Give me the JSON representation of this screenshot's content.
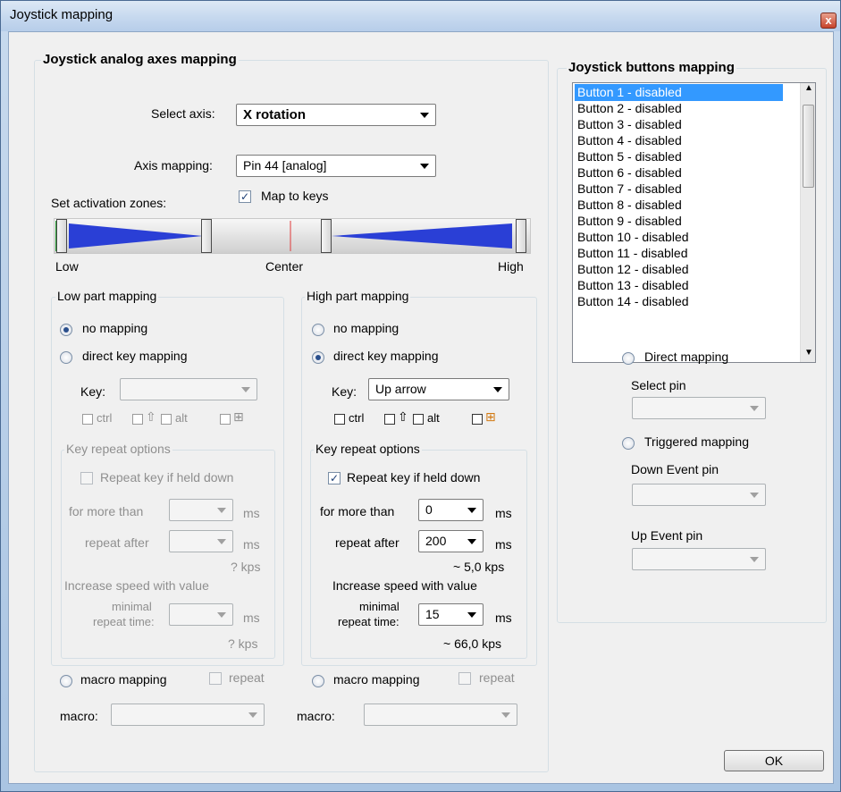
{
  "window": {
    "title": "Joystick mapping",
    "close_glyph": "x"
  },
  "analog": {
    "group_title": "Joystick analog axes mapping",
    "select_axis_label": "Select axis:",
    "select_axis_value": "X rotation",
    "axis_mapping_label": "Axis mapping:",
    "axis_mapping_value": "Pin 44 [analog]",
    "map_to_keys_label": "Map to keys",
    "map_to_keys_checked": true,
    "activation_label": "Set activation zones:",
    "zone_low": "Low",
    "zone_center": "Center",
    "zone_high": "High"
  },
  "low": {
    "title": "Low part mapping",
    "no_mapping": "no mapping",
    "direct": "direct key mapping",
    "key_label": "Key:",
    "key_value": "",
    "ctrl": "ctrl",
    "alt": "alt",
    "shift_glyph": "⇧",
    "win_glyph": "⊞",
    "repeat_group": "Key repeat options",
    "repeat_check": "Repeat key if held down",
    "for_more_than": "for more than",
    "repeat_after": "repeat after",
    "ms": "ms",
    "kps1": "? kps",
    "increase": "Increase speed with value",
    "minimal": "minimal",
    "repeat_time": "repeat time:",
    "kps2": "? kps",
    "macro_mapping": "macro mapping",
    "repeat": "repeat",
    "macro_label": "macro:"
  },
  "high": {
    "title": "High part mapping",
    "no_mapping": "no mapping",
    "direct": "direct key mapping",
    "key_label": "Key:",
    "key_value": "Up arrow",
    "ctrl": "ctrl",
    "alt": "alt",
    "shift_glyph": "⇧",
    "win_glyph": "⊞",
    "repeat_group": "Key repeat options",
    "repeat_check": "Repeat key if held down",
    "repeat_checked": true,
    "for_more_than": "for more than",
    "for_more_than_value": "0",
    "repeat_after": "repeat after",
    "repeat_after_value": "200",
    "ms": "ms",
    "kps1": "~ 5,0 kps",
    "increase": "Increase speed with value",
    "minimal": "minimal",
    "repeat_time": "repeat time:",
    "minimal_value": "15",
    "kps2": "~ 66,0 kps",
    "macro_mapping": "macro mapping",
    "repeat": "repeat",
    "macro_label": "macro:"
  },
  "buttons": {
    "group_title": "Joystick buttons mapping",
    "items": [
      "Button 1 - disabled",
      "Button 2 - disabled",
      "Button 3 - disabled",
      "Button 4 - disabled",
      "Button 5 - disabled",
      "Button 6 - disabled",
      "Button 7 - disabled",
      "Button 8 - disabled",
      "Button 9 - disabled",
      "Button 10 - disabled",
      "Button 11 - disabled",
      "Button 12 - disabled",
      "Button 13 - disabled",
      "Button 14 - disabled"
    ],
    "selected_index": 0,
    "direct_mapping": "Direct mapping",
    "select_pin": "Select pin",
    "triggered_mapping": "Triggered mapping",
    "down_event_pin": "Down Event pin",
    "up_event_pin": "Up Event pin"
  },
  "ok_label": "OK",
  "colors": {
    "slider_zone": "#2a3fd6",
    "slider_start": "#2fa33b",
    "center_line": "#e03a3a",
    "selection": "#3399ff"
  }
}
